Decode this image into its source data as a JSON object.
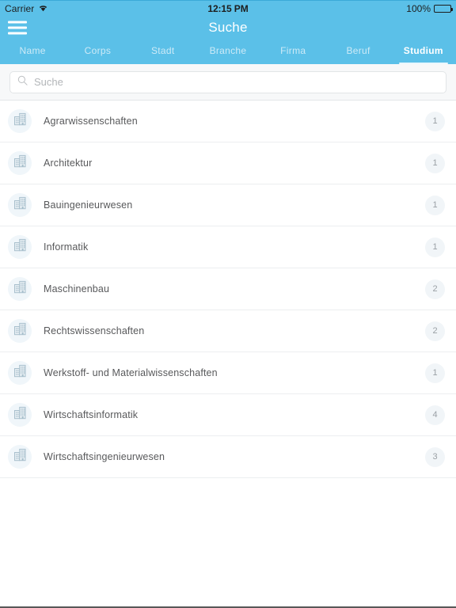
{
  "statusbar": {
    "carrier": "Carrier",
    "wifi_icon": "wifi-icon",
    "time": "12:15 PM",
    "battery_percent": "100%",
    "battery_icon": "battery-full-icon"
  },
  "navbar": {
    "menu_icon": "hamburger-menu-icon",
    "title": "Suche"
  },
  "tabs": [
    {
      "label": "Name",
      "active": false
    },
    {
      "label": "Corps",
      "active": false
    },
    {
      "label": "Stadt",
      "active": false
    },
    {
      "label": "Branche",
      "active": false
    },
    {
      "label": "Firma",
      "active": false
    },
    {
      "label": "Beruf",
      "active": false
    },
    {
      "label": "Studium",
      "active": true
    }
  ],
  "search": {
    "icon": "search-icon",
    "placeholder": "Suche",
    "value": ""
  },
  "list": {
    "row_icon": "building-icon",
    "items": [
      {
        "label": "Agrarwissenschaften",
        "count": "1"
      },
      {
        "label": "Architektur",
        "count": "1"
      },
      {
        "label": "Bauingenieurwesen",
        "count": "1"
      },
      {
        "label": "Informatik",
        "count": "1"
      },
      {
        "label": "Maschinenbau",
        "count": "2"
      },
      {
        "label": "Rechtswissenschaften",
        "count": "2"
      },
      {
        "label": "Werkstoff- und Materialwissenschaften",
        "count": "1"
      },
      {
        "label": "Wirtschaftsinformatik",
        "count": "4"
      },
      {
        "label": "Wirtschaftsingenieurwesen",
        "count": "3"
      }
    ]
  },
  "colors": {
    "brand_blue": "#5bc0e8",
    "tab_inactive": "#cdeaf7",
    "avatar_bg": "#f0f6fa",
    "badge_bg": "#f1f5f8",
    "icon_blue_grey": "#aac2ce",
    "text_primary": "#58595b",
    "separator": "#eceef0"
  }
}
